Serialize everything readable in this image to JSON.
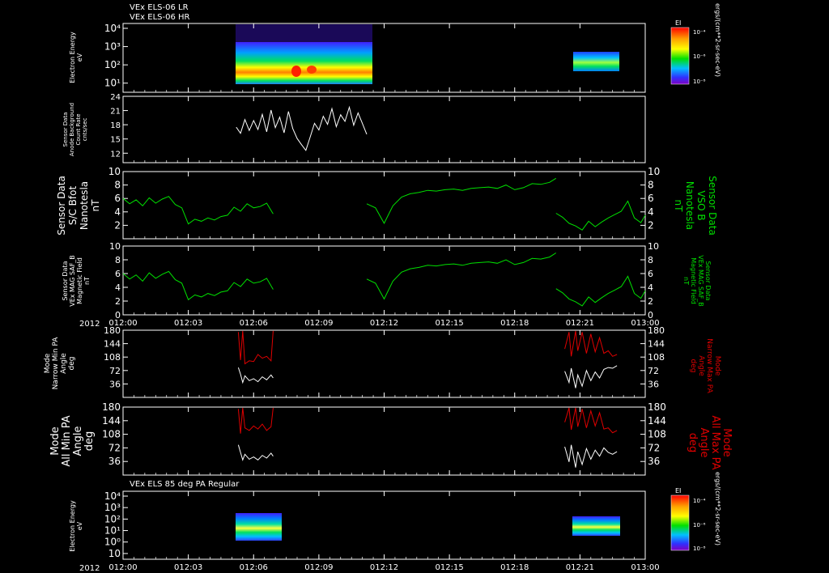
{
  "header": {
    "line1": "VEx ELS-06 LR",
    "line2": "VEx ELS-06 HR",
    "panel7_title": "VEx ELS 85 deg PA Regular"
  },
  "colors": {
    "white": "#ffffff",
    "green": "#00e000",
    "red": "#e00000",
    "frame": "#ffffff"
  },
  "time_axis": {
    "year": "2012",
    "tick_labels": [
      "012:00",
      "012:03",
      "012:06",
      "012:09",
      "012:12",
      "012:15",
      "012:18",
      "012:21",
      "013:00"
    ],
    "tick_minutes": [
      0,
      3,
      6,
      9,
      12,
      15,
      18,
      21,
      24
    ]
  },
  "colorbar": {
    "label": "EI",
    "ticks": [
      "10⁻⁴",
      "10⁻⁶",
      "10⁻⁸"
    ],
    "units": "ergs/(cm**2-sr-sec-eV)"
  },
  "chart_data": [
    {
      "type": "heatmap",
      "ylabel": [
        "Electron Energy",
        "eV"
      ],
      "y_tick_labels": [
        "10⁴",
        "10³",
        "10²",
        "10¹"
      ],
      "segments": [
        {
          "x": [
            5.2,
            11.2
          ],
          "y_log_range": [
            0.1,
            4.1
          ]
        },
        {
          "x": [
            20.3,
            22.4
          ],
          "y_log_range": [
            0.6,
            1.9
          ]
        }
      ]
    },
    {
      "type": "line",
      "ylabel": [
        "Sensor Data",
        "Anode Background",
        "Count Rate",
        "cnts/sec"
      ],
      "ylim": [
        10,
        24
      ],
      "y_ticks": [
        12,
        15,
        18,
        21,
        24
      ],
      "series": [
        {
          "color": "#ffffff",
          "x": [
            5.2,
            5.4,
            5.6,
            5.8,
            6.0,
            6.2,
            6.4,
            6.6,
            6.8,
            7.0,
            7.2,
            7.4,
            7.6,
            7.8,
            8.0,
            8.2,
            8.4,
            8.6,
            8.8,
            9.0,
            9.2,
            9.4,
            9.6,
            9.8,
            10.0,
            10.2,
            10.4,
            10.6,
            10.8,
            11.0,
            11.2
          ],
          "values": [
            17.5,
            16.2,
            19.1,
            16.8,
            18.9,
            17.0,
            20.2,
            16.5,
            21.1,
            17.4,
            19.6,
            16.3,
            20.8,
            17.2,
            15.1,
            13.8,
            12.6,
            15.4,
            18.3,
            16.9,
            19.8,
            18.1,
            21.4,
            17.6,
            20.1,
            18.7,
            21.7,
            17.9,
            20.5,
            18.3,
            16.0
          ]
        }
      ]
    },
    {
      "type": "line",
      "ylabel": [
        "Sensor Data",
        "S/C Bfot",
        "Nanotesla",
        "nT"
      ],
      "right_label": [
        "Sensor Data",
        "VSO B",
        "Nanotesla",
        "nT"
      ],
      "ylim": [
        0,
        10
      ],
      "y_ticks": [
        2,
        4,
        6,
        8,
        10
      ],
      "series": [
        {
          "color": "#00e000",
          "x": [
            0.0,
            0.3,
            0.6,
            0.9,
            1.2,
            1.5,
            1.8,
            2.1,
            2.4,
            2.7,
            3.0,
            3.3,
            3.6,
            3.9,
            4.2,
            4.5,
            4.8,
            5.1,
            5.4,
            5.7,
            6.0,
            6.3,
            6.6,
            6.9
          ],
          "values": [
            6.0,
            5.2,
            5.8,
            4.9,
            6.1,
            5.3,
            5.9,
            6.3,
            5.1,
            4.6,
            2.2,
            2.9,
            2.6,
            3.1,
            2.8,
            3.3,
            3.5,
            4.7,
            4.1,
            5.2,
            4.6,
            4.8,
            5.3,
            3.7
          ]
        },
        {
          "color": "#00e000",
          "x": [
            11.2,
            11.6,
            12.0,
            12.4,
            12.8,
            13.2,
            13.6,
            14.0,
            14.4,
            14.8,
            15.2,
            15.6,
            16.0,
            16.4,
            16.8,
            17.2,
            17.6,
            18.0,
            18.4,
            18.8,
            19.2,
            19.6,
            19.9
          ],
          "values": [
            5.2,
            4.6,
            2.3,
            4.9,
            6.2,
            6.7,
            6.9,
            7.2,
            7.1,
            7.3,
            7.4,
            7.2,
            7.5,
            7.6,
            7.7,
            7.5,
            8.0,
            7.3,
            7.6,
            8.2,
            8.1,
            8.4,
            9.0
          ]
        },
        {
          "color": "#00e000",
          "x": [
            19.9,
            20.2,
            20.5,
            20.8,
            21.1,
            21.4,
            21.7,
            22.0,
            22.3,
            22.6,
            22.9,
            23.2,
            23.5,
            23.8,
            24.0
          ],
          "values": [
            3.8,
            3.2,
            2.3,
            1.9,
            1.3,
            2.6,
            1.8,
            2.5,
            3.1,
            3.6,
            4.1,
            5.6,
            3.1,
            2.4,
            3.5
          ]
        }
      ]
    },
    {
      "type": "line",
      "ylabel": [
        "Sensor Data",
        "VEx MAG SAF_B",
        "Magnetic Field",
        "nT"
      ],
      "right_label": [
        "Sensor Data",
        "VEx MAG SAF_B",
        "Magnetic Field",
        "nT"
      ],
      "ylim": [
        0,
        10
      ],
      "y_ticks": [
        0,
        2,
        4,
        6,
        8,
        10
      ],
      "series": [
        {
          "color": "#00e000",
          "x": [
            0.0,
            0.3,
            0.6,
            0.9,
            1.2,
            1.5,
            1.8,
            2.1,
            2.4,
            2.7,
            3.0,
            3.3,
            3.6,
            3.9,
            4.2,
            4.5,
            4.8,
            5.1,
            5.4,
            5.7,
            6.0,
            6.3,
            6.6,
            6.9
          ],
          "values": [
            6.0,
            5.2,
            5.8,
            4.9,
            6.1,
            5.3,
            5.9,
            6.3,
            5.1,
            4.6,
            2.2,
            2.9,
            2.6,
            3.1,
            2.8,
            3.3,
            3.5,
            4.7,
            4.1,
            5.2,
            4.6,
            4.8,
            5.3,
            3.7
          ]
        },
        {
          "color": "#00e000",
          "x": [
            11.2,
            11.6,
            12.0,
            12.4,
            12.8,
            13.2,
            13.6,
            14.0,
            14.4,
            14.8,
            15.2,
            15.6,
            16.0,
            16.4,
            16.8,
            17.2,
            17.6,
            18.0,
            18.4,
            18.8,
            19.2,
            19.6,
            19.9
          ],
          "values": [
            5.2,
            4.6,
            2.3,
            4.9,
            6.2,
            6.7,
            6.9,
            7.2,
            7.1,
            7.3,
            7.4,
            7.2,
            7.5,
            7.6,
            7.7,
            7.5,
            8.0,
            7.3,
            7.6,
            8.2,
            8.1,
            8.4,
            9.0
          ]
        },
        {
          "color": "#00e000",
          "x": [
            19.9,
            20.2,
            20.5,
            20.8,
            21.1,
            21.4,
            21.7,
            22.0,
            22.3,
            22.6,
            22.9,
            23.2,
            23.5,
            23.8,
            24.0
          ],
          "values": [
            3.8,
            3.2,
            2.3,
            1.9,
            1.3,
            2.6,
            1.8,
            2.5,
            3.1,
            3.6,
            4.1,
            5.6,
            3.1,
            2.4,
            3.5
          ]
        }
      ]
    },
    {
      "type": "line",
      "ylabel": [
        "Mode",
        "Narrow Min PA",
        "Angle",
        "deg"
      ],
      "right_label": [
        "Mode",
        "Narrow Max PA",
        "Angle",
        "deg"
      ],
      "ylim": [
        0,
        180
      ],
      "y_ticks": [
        36,
        72,
        108,
        144,
        180
      ],
      "series": [
        {
          "color": "#ffffff",
          "x": [
            5.3,
            5.4,
            5.5,
            5.6,
            5.8,
            6.0,
            6.2,
            6.4,
            6.6,
            6.8,
            6.9
          ],
          "values": [
            80,
            62,
            40,
            58,
            45,
            50,
            42,
            55,
            47,
            60,
            52
          ]
        },
        {
          "color": "#e00000",
          "x": [
            5.3,
            5.4,
            5.5,
            5.6,
            5.8,
            6.0,
            6.2,
            6.4,
            6.6,
            6.8,
            6.9
          ],
          "values": [
            175,
            100,
            178,
            90,
            98,
            96,
            115,
            105,
            110,
            98,
            178
          ]
        },
        {
          "color": "#ffffff",
          "x": [
            20.3,
            20.5,
            20.6,
            20.8,
            20.9,
            21.1,
            21.3,
            21.5,
            21.7,
            21.9,
            22.1,
            22.3,
            22.5,
            22.7
          ],
          "values": [
            70,
            40,
            78,
            25,
            60,
            30,
            72,
            45,
            68,
            52,
            75,
            80,
            78,
            85
          ]
        },
        {
          "color": "#e00000",
          "x": [
            20.3,
            20.5,
            20.6,
            20.8,
            20.9,
            21.1,
            21.3,
            21.5,
            21.7,
            21.9,
            22.1,
            22.3,
            22.5,
            22.7
          ],
          "values": [
            130,
            175,
            110,
            178,
            125,
            175,
            118,
            170,
            122,
            160,
            118,
            125,
            110,
            115
          ]
        }
      ]
    },
    {
      "type": "line",
      "ylabel": [
        "Mode",
        "All Min PA",
        "Angle",
        "deg"
      ],
      "right_label": [
        "Mode",
        "All Max PA",
        "Angle",
        "deg"
      ],
      "ylim": [
        0,
        180
      ],
      "y_ticks": [
        36,
        72,
        108,
        144,
        180
      ],
      "series": [
        {
          "color": "#ffffff",
          "x": [
            5.3,
            5.4,
            5.5,
            5.6,
            5.8,
            6.0,
            6.2,
            6.4,
            6.6,
            6.8,
            6.9
          ],
          "values": [
            80,
            60,
            40,
            55,
            42,
            48,
            40,
            52,
            45,
            58,
            50
          ]
        },
        {
          "color": "#e00000",
          "x": [
            5.3,
            5.4,
            5.5,
            5.6,
            5.8,
            6.0,
            6.2,
            6.4,
            6.6,
            6.8,
            6.9
          ],
          "values": [
            175,
            110,
            178,
            125,
            118,
            130,
            122,
            135,
            118,
            128,
            178
          ]
        },
        {
          "color": "#ffffff",
          "x": [
            20.3,
            20.5,
            20.6,
            20.8,
            20.9,
            21.1,
            21.3,
            21.5,
            21.7,
            21.9,
            22.1,
            22.3,
            22.5,
            22.7
          ],
          "values": [
            75,
            35,
            80,
            20,
            62,
            28,
            70,
            42,
            66,
            50,
            72,
            60,
            55,
            62
          ]
        },
        {
          "color": "#e00000",
          "x": [
            20.3,
            20.5,
            20.6,
            20.8,
            20.9,
            21.1,
            21.3,
            21.5,
            21.7,
            21.9,
            22.1,
            22.3,
            22.5,
            22.7
          ],
          "values": [
            140,
            178,
            120,
            178,
            128,
            175,
            125,
            170,
            130,
            165,
            122,
            125,
            112,
            118
          ]
        }
      ]
    },
    {
      "type": "heatmap",
      "ylabel": [
        "Electron Energy",
        "eV"
      ],
      "y_tick_labels": [
        "10⁴",
        "10³",
        "10²",
        "10¹",
        "10⁰",
        "10"
      ],
      "segments": [
        {
          "x": [
            5.2,
            7.0
          ],
          "y_log_range": [
            0.5,
            2.4
          ]
        },
        {
          "x": [
            20.3,
            22.4
          ],
          "y_log_range": [
            1.1,
            2.0
          ]
        }
      ]
    }
  ]
}
